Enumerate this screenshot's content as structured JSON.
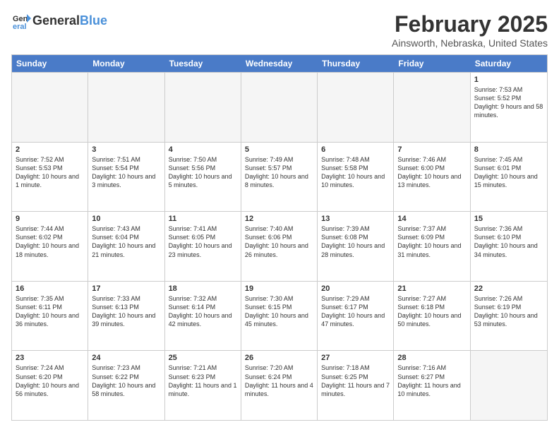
{
  "header": {
    "logo_general": "General",
    "logo_blue": "Blue",
    "month_title": "February 2025",
    "location": "Ainsworth, Nebraska, United States"
  },
  "days_of_week": [
    "Sunday",
    "Monday",
    "Tuesday",
    "Wednesday",
    "Thursday",
    "Friday",
    "Saturday"
  ],
  "rows": [
    [
      {
        "day": "",
        "info": ""
      },
      {
        "day": "",
        "info": ""
      },
      {
        "day": "",
        "info": ""
      },
      {
        "day": "",
        "info": ""
      },
      {
        "day": "",
        "info": ""
      },
      {
        "day": "",
        "info": ""
      },
      {
        "day": "1",
        "info": "Sunrise: 7:53 AM\nSunset: 5:52 PM\nDaylight: 9 hours and 58 minutes."
      }
    ],
    [
      {
        "day": "2",
        "info": "Sunrise: 7:52 AM\nSunset: 5:53 PM\nDaylight: 10 hours and 1 minute."
      },
      {
        "day": "3",
        "info": "Sunrise: 7:51 AM\nSunset: 5:54 PM\nDaylight: 10 hours and 3 minutes."
      },
      {
        "day": "4",
        "info": "Sunrise: 7:50 AM\nSunset: 5:56 PM\nDaylight: 10 hours and 5 minutes."
      },
      {
        "day": "5",
        "info": "Sunrise: 7:49 AM\nSunset: 5:57 PM\nDaylight: 10 hours and 8 minutes."
      },
      {
        "day": "6",
        "info": "Sunrise: 7:48 AM\nSunset: 5:58 PM\nDaylight: 10 hours and 10 minutes."
      },
      {
        "day": "7",
        "info": "Sunrise: 7:46 AM\nSunset: 6:00 PM\nDaylight: 10 hours and 13 minutes."
      },
      {
        "day": "8",
        "info": "Sunrise: 7:45 AM\nSunset: 6:01 PM\nDaylight: 10 hours and 15 minutes."
      }
    ],
    [
      {
        "day": "9",
        "info": "Sunrise: 7:44 AM\nSunset: 6:02 PM\nDaylight: 10 hours and 18 minutes."
      },
      {
        "day": "10",
        "info": "Sunrise: 7:43 AM\nSunset: 6:04 PM\nDaylight: 10 hours and 21 minutes."
      },
      {
        "day": "11",
        "info": "Sunrise: 7:41 AM\nSunset: 6:05 PM\nDaylight: 10 hours and 23 minutes."
      },
      {
        "day": "12",
        "info": "Sunrise: 7:40 AM\nSunset: 6:06 PM\nDaylight: 10 hours and 26 minutes."
      },
      {
        "day": "13",
        "info": "Sunrise: 7:39 AM\nSunset: 6:08 PM\nDaylight: 10 hours and 28 minutes."
      },
      {
        "day": "14",
        "info": "Sunrise: 7:37 AM\nSunset: 6:09 PM\nDaylight: 10 hours and 31 minutes."
      },
      {
        "day": "15",
        "info": "Sunrise: 7:36 AM\nSunset: 6:10 PM\nDaylight: 10 hours and 34 minutes."
      }
    ],
    [
      {
        "day": "16",
        "info": "Sunrise: 7:35 AM\nSunset: 6:11 PM\nDaylight: 10 hours and 36 minutes."
      },
      {
        "day": "17",
        "info": "Sunrise: 7:33 AM\nSunset: 6:13 PM\nDaylight: 10 hours and 39 minutes."
      },
      {
        "day": "18",
        "info": "Sunrise: 7:32 AM\nSunset: 6:14 PM\nDaylight: 10 hours and 42 minutes."
      },
      {
        "day": "19",
        "info": "Sunrise: 7:30 AM\nSunset: 6:15 PM\nDaylight: 10 hours and 45 minutes."
      },
      {
        "day": "20",
        "info": "Sunrise: 7:29 AM\nSunset: 6:17 PM\nDaylight: 10 hours and 47 minutes."
      },
      {
        "day": "21",
        "info": "Sunrise: 7:27 AM\nSunset: 6:18 PM\nDaylight: 10 hours and 50 minutes."
      },
      {
        "day": "22",
        "info": "Sunrise: 7:26 AM\nSunset: 6:19 PM\nDaylight: 10 hours and 53 minutes."
      }
    ],
    [
      {
        "day": "23",
        "info": "Sunrise: 7:24 AM\nSunset: 6:20 PM\nDaylight: 10 hours and 56 minutes."
      },
      {
        "day": "24",
        "info": "Sunrise: 7:23 AM\nSunset: 6:22 PM\nDaylight: 10 hours and 58 minutes."
      },
      {
        "day": "25",
        "info": "Sunrise: 7:21 AM\nSunset: 6:23 PM\nDaylight: 11 hours and 1 minute."
      },
      {
        "day": "26",
        "info": "Sunrise: 7:20 AM\nSunset: 6:24 PM\nDaylight: 11 hours and 4 minutes."
      },
      {
        "day": "27",
        "info": "Sunrise: 7:18 AM\nSunset: 6:25 PM\nDaylight: 11 hours and 7 minutes."
      },
      {
        "day": "28",
        "info": "Sunrise: 7:16 AM\nSunset: 6:27 PM\nDaylight: 11 hours and 10 minutes."
      },
      {
        "day": "",
        "info": ""
      }
    ]
  ]
}
